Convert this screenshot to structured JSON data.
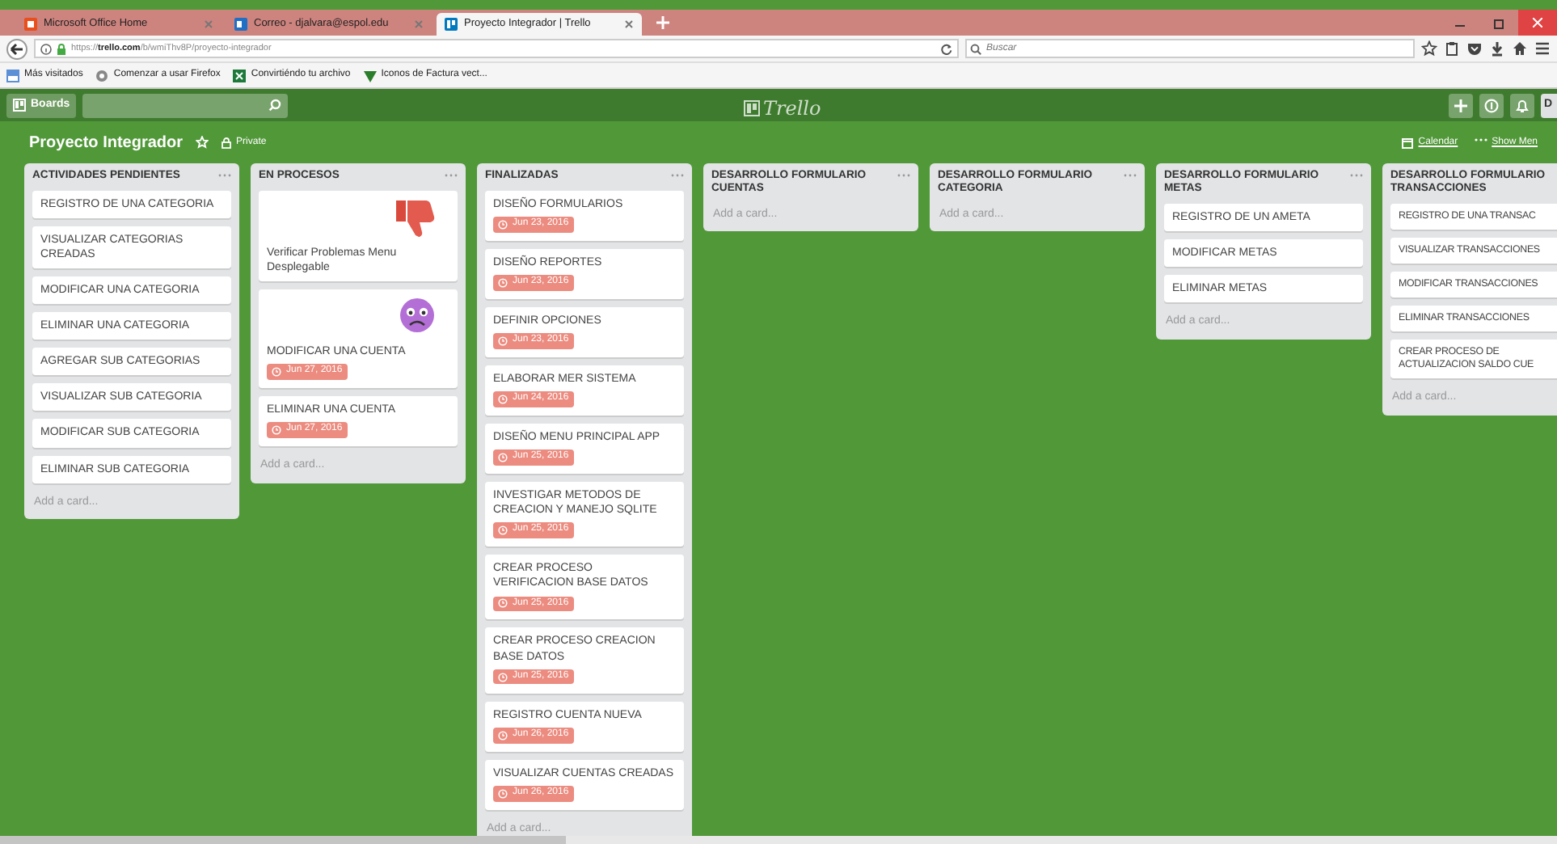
{
  "browser": {
    "tabs": [
      {
        "title": "Microsoft Office Home",
        "selected": false
      },
      {
        "title": "Correo - djalvara@espol.edu",
        "selected": false
      },
      {
        "title": "Proyecto Integrador | Trello",
        "selected": true
      }
    ],
    "url_host": "trello.com",
    "url_prefix": "https://",
    "url_path": "/b/wmiThv8P/proyecto-integrador",
    "search_placeholder": "Buscar",
    "bookmarks": [
      "Más visitados",
      "Comenzar a usar Firefox",
      "Convirtiéndo tu archivo",
      "Iconos de Factura vect..."
    ]
  },
  "header": {
    "boards_label": "Boards",
    "logo": "Trello",
    "user_initial": "D"
  },
  "board": {
    "title": "Proyecto Integrador",
    "visibility": "Private",
    "calendar": "Calendar",
    "show_menu": "Show Men"
  },
  "lists": [
    {
      "title": "ACTIVIDADES PENDIENTES",
      "add_card": "Add a card...",
      "cards": [
        {
          "title": "REGISTRO DE UNA CATEGORIA"
        },
        {
          "title": "VISUALIZAR CATEGORIAS CREADAS"
        },
        {
          "title": "MODIFICAR UNA CATEGORIA"
        },
        {
          "title": "ELIMINAR UNA CATEGORIA"
        },
        {
          "title": "AGREGAR SUB CATEGORIAS"
        },
        {
          "title": "VISUALIZAR SUB CATEGORIA"
        },
        {
          "title": "MODIFICAR SUB CATEGORIA"
        },
        {
          "title": "ELIMINAR SUB CATEGORIA"
        }
      ]
    },
    {
      "title": "EN PROCESOS",
      "add_card": "Add a card...",
      "cards": [
        {
          "title": "Verificar Problemas Menu Desplegable",
          "kind": "thumbsdown"
        },
        {
          "title": "MODIFICAR UNA CUENTA",
          "due": "Jun 27, 2016",
          "kind": "worried"
        },
        {
          "title": "ELIMINAR UNA CUENTA",
          "due": "Jun 27, 2016",
          "kind": "plain"
        }
      ]
    },
    {
      "title": "FINALIZADAS",
      "add_card": "Add a card...",
      "cards": [
        {
          "title": "DISEÑO FORMULARIOS",
          "due": "Jun 23, 2016"
        },
        {
          "title": "DISEÑO REPORTES",
          "due": "Jun 23, 2016"
        },
        {
          "title": "DEFINIR OPCIONES",
          "due": "Jun 23, 2016"
        },
        {
          "title": "ELABORAR MER SISTEMA",
          "due": "Jun 24, 2016"
        },
        {
          "title": "DISEÑO MENU PRINCIPAL APP",
          "due": "Jun 25, 2016"
        },
        {
          "title": "INVESTIGAR METODOS DE CREACION Y MANEJO SQLITE",
          "due": "Jun 25, 2016"
        },
        {
          "title": "CREAR PROCESO VERIFICACION BASE DATOS",
          "due": "Jun 25, 2016"
        },
        {
          "title": "CREAR PROCESO CREACION BASE DATOS",
          "due": "Jun 25, 2016"
        },
        {
          "title": "REGISTRO CUENTA NUEVA",
          "due": "Jun 26, 2016"
        },
        {
          "title": "VISUALIZAR CUENTAS CREADAS",
          "due": "Jun 26, 2016"
        }
      ]
    },
    {
      "title": "DESARROLLO FORMULARIO CUENTAS",
      "add_card": "Add a card..."
    },
    {
      "title": "DESARROLLO FORMULARIO CATEGORIA",
      "add_card": "Add a card..."
    },
    {
      "title": "DESARROLLO FORMULARIO METAS",
      "add_card": "Add a card...",
      "cards": [
        {
          "title": "REGISTRO DE UN AMETA"
        },
        {
          "title": "MODIFICAR METAS"
        },
        {
          "title": "ELIMINAR METAS"
        }
      ]
    },
    {
      "title": "DESARROLLO FORMULARIO TRANSACCIONES",
      "add_card": "Add a card...",
      "cards": [
        {
          "title": "REGISTRO DE UNA TRANSAC"
        },
        {
          "title": "VISUALIZAR TRANSACCIONES"
        },
        {
          "title": "MODIFICAR TRANSACCIONES"
        },
        {
          "title": "ELIMINAR TRANSACCIONES"
        },
        {
          "title": "CREAR PROCESO DE ACTUALIZACION SALDO CUE"
        }
      ]
    }
  ]
}
